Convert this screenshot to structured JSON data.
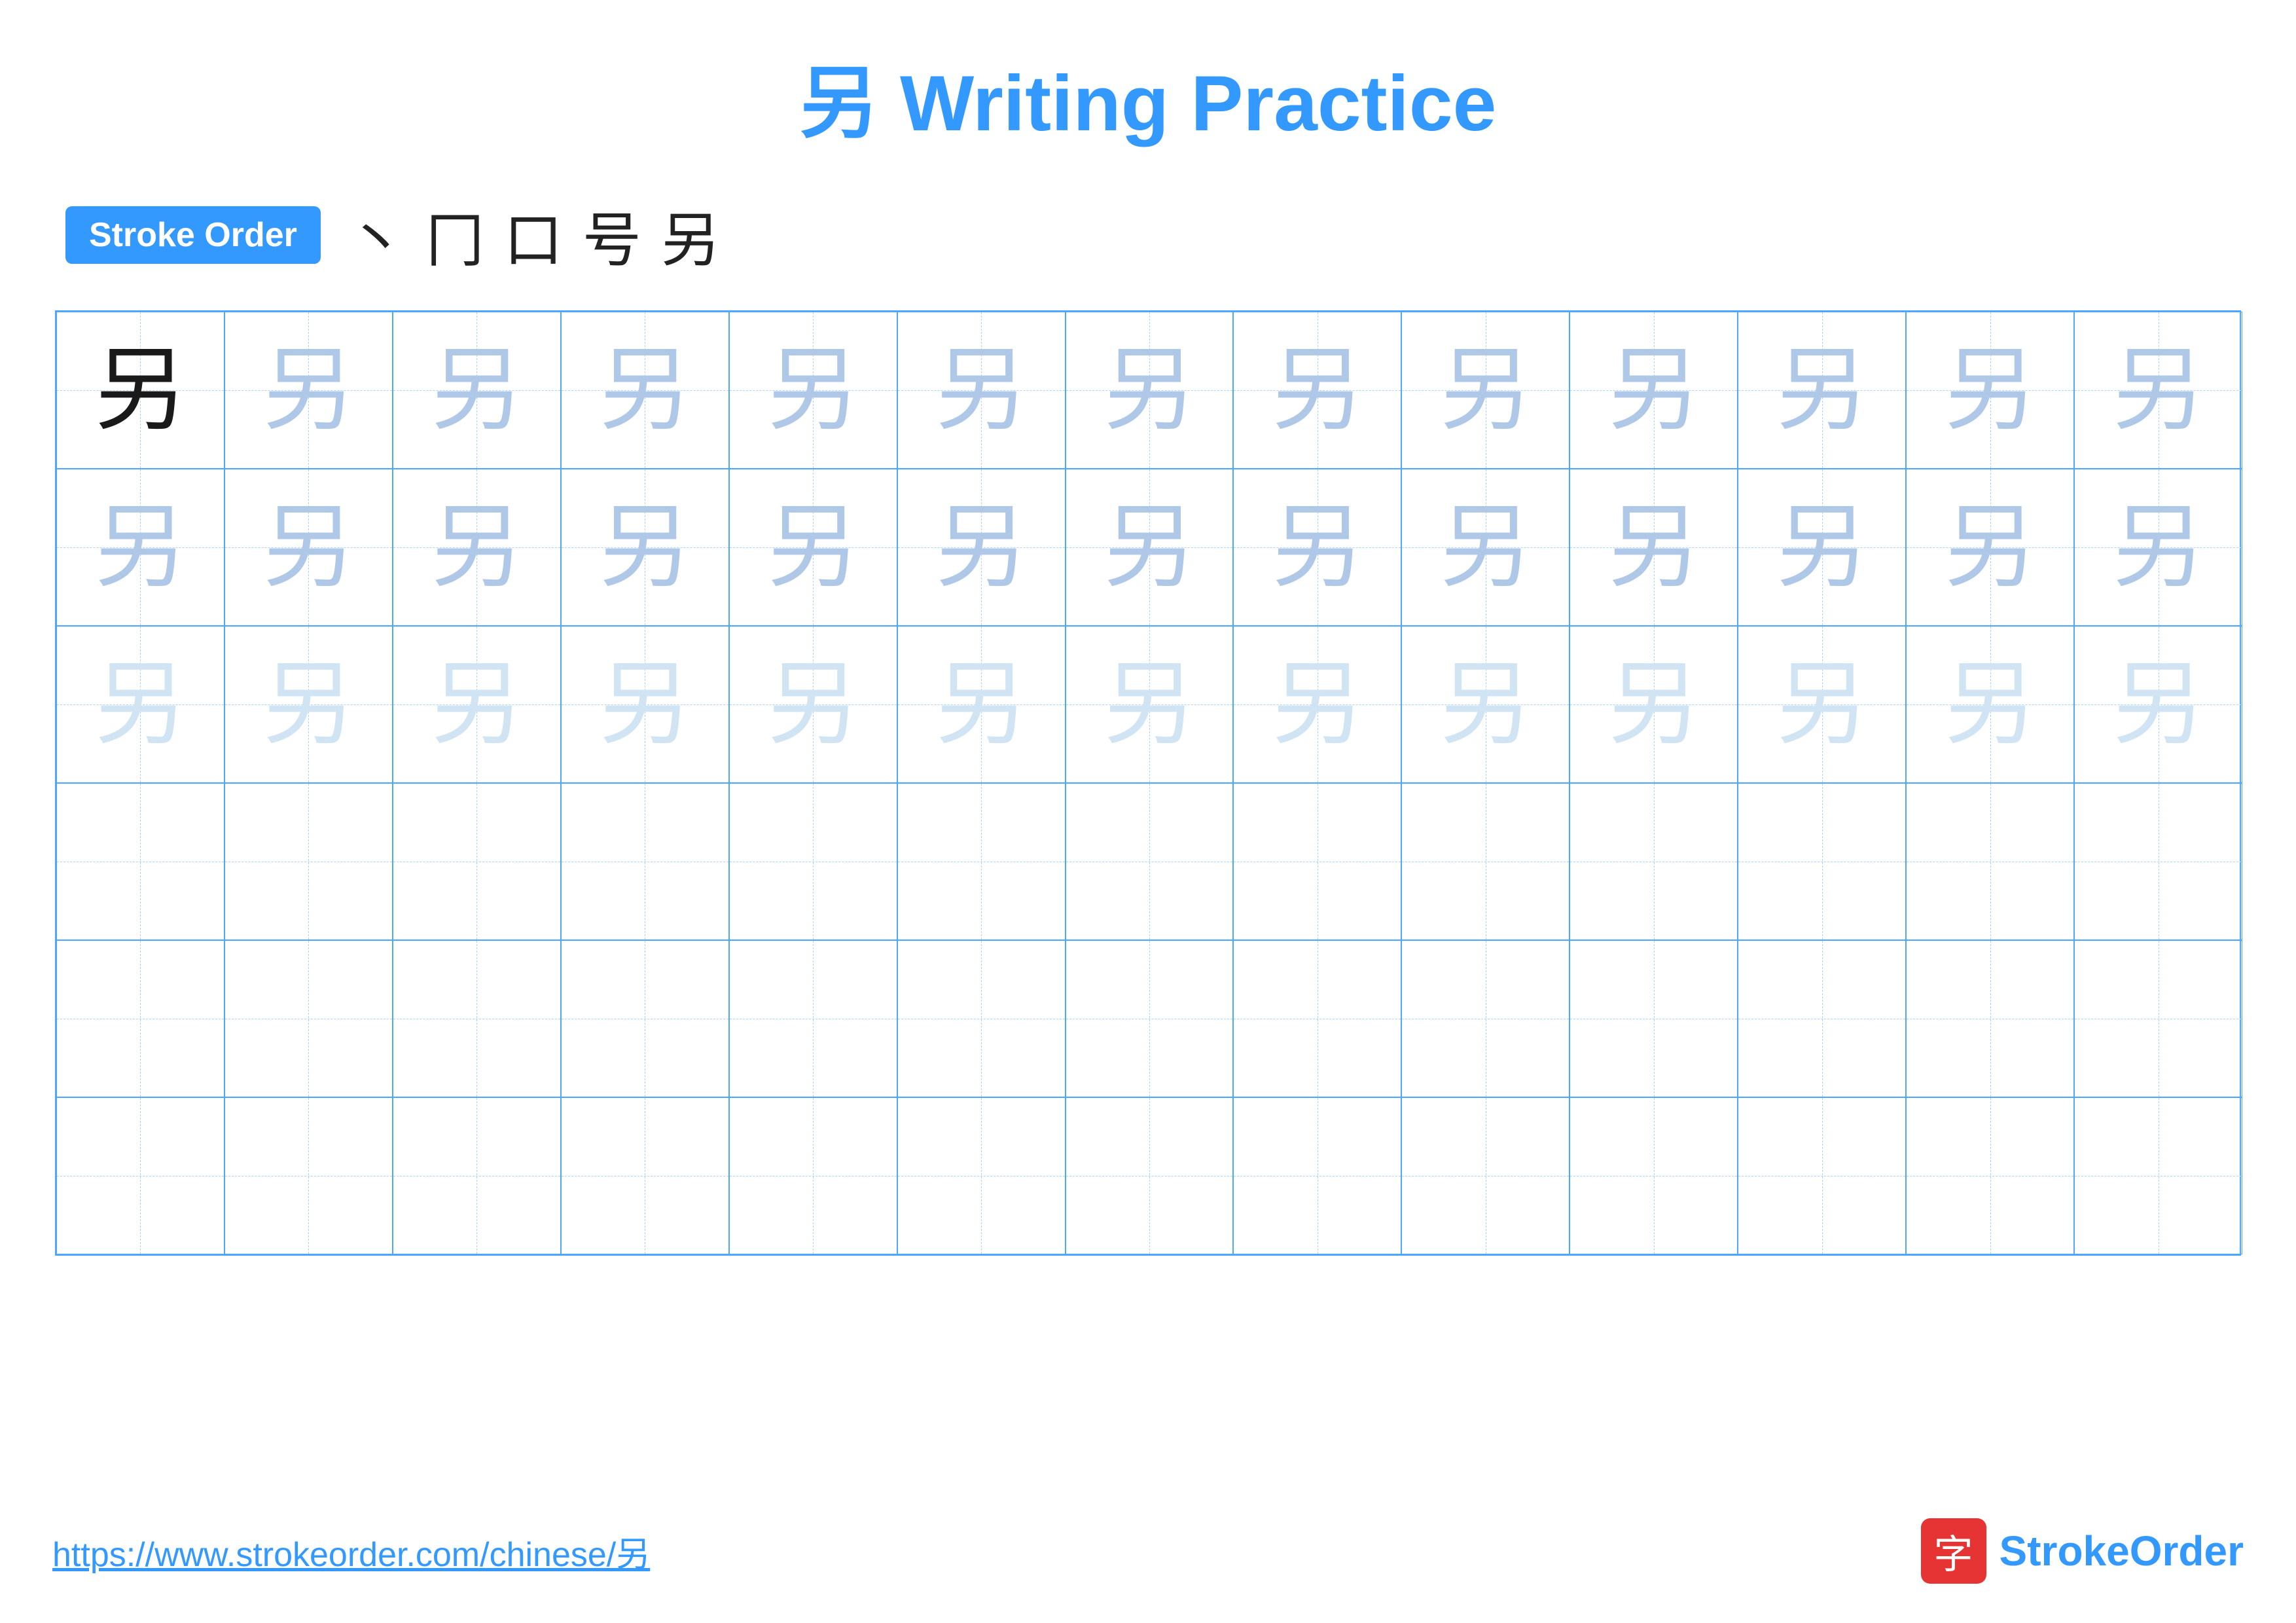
{
  "title": {
    "char": "另",
    "label": "Writing Practice",
    "full": "另 Writing Practice"
  },
  "stroke_order": {
    "badge_label": "Stroke Order",
    "strokes": [
      "丶",
      "冂",
      "口",
      "号",
      "另"
    ]
  },
  "grid": {
    "rows": 6,
    "cols": 13,
    "char": "另",
    "row_styles": [
      "dark",
      "medium",
      "light",
      "empty",
      "empty",
      "empty"
    ]
  },
  "footer": {
    "url": "https://www.strokeorder.com/chinese/另",
    "logo_char": "字",
    "logo_text": "StrokeOrder"
  }
}
